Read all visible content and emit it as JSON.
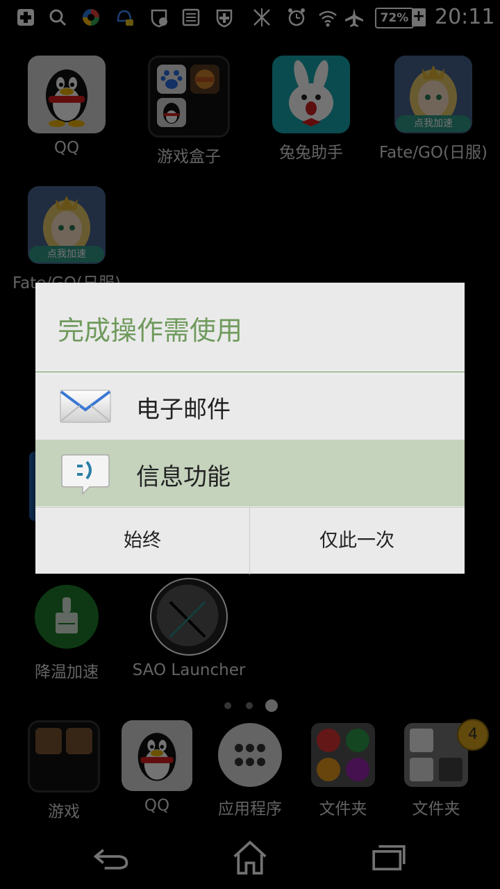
{
  "status": {
    "battery": "72%",
    "battery_plus": "+",
    "time": "20:11"
  },
  "apps_row1": [
    {
      "label": "QQ"
    },
    {
      "label": "游戏盒子"
    },
    {
      "label": "兔兔助手"
    },
    {
      "label": "Fate/GO(日服)",
      "badge_text": "点我加速"
    }
  ],
  "apps_row2": [
    {
      "label": "Fate/GO(日服)",
      "badge_text": "点我加速"
    }
  ],
  "apps_row3": [
    {
      "label": "降温加速"
    },
    {
      "label": "SAO Launcher"
    }
  ],
  "dock": [
    {
      "label": "游戏"
    },
    {
      "label": "QQ"
    },
    {
      "label": "应用程序"
    },
    {
      "label": "文件夹"
    },
    {
      "label": "文件夹",
      "badge": "4"
    }
  ],
  "dialog": {
    "title": "完成操作需使用",
    "items": [
      {
        "label": "电子邮件",
        "icon": "mail-envelope-icon"
      },
      {
        "label": "信息功能",
        "icon": "message-bubble-icon",
        "selected": true
      }
    ],
    "buttons": {
      "always": "始终",
      "once": "仅此一次"
    }
  },
  "colors": {
    "accent": "#6f9a5c",
    "selected_bg": "#c5d3bd",
    "dialog_bg": "#eaeaea"
  },
  "page_indicator": {
    "count": 3,
    "active": 3
  }
}
